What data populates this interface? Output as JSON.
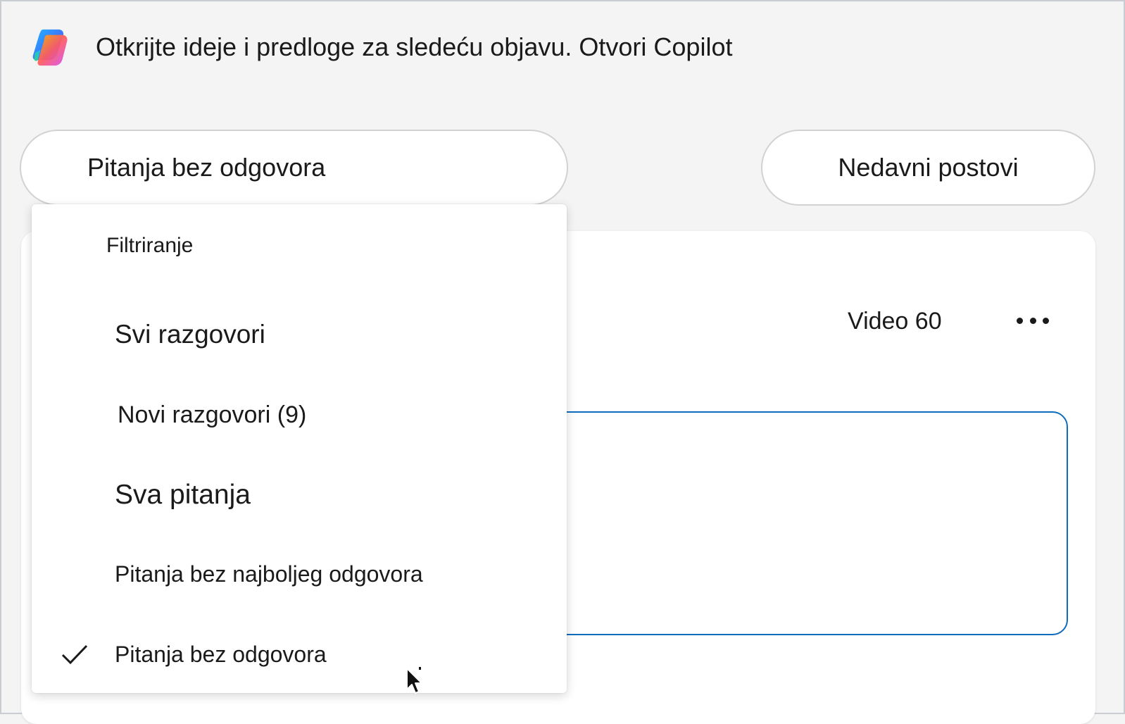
{
  "banner": {
    "text": "Otkrijte ideje i predloge za sledeću objavu. Otvori Copilot",
    "logo_icon": "copilot-logo-icon"
  },
  "filter_button": {
    "label": "Pitanja bez odgovora"
  },
  "recent_button": {
    "label": "Nedavni postovi"
  },
  "card": {
    "video_label": "Video 60",
    "more_icon": "more-horizontal-icon"
  },
  "menu": {
    "header": "Filtriranje",
    "items": [
      {
        "label": "Svi razgovori",
        "selected": false
      },
      {
        "label": "Novi razgovori (9)",
        "selected": false
      },
      {
        "label": "Sva pitanja",
        "selected": false
      },
      {
        "label": "Pitanja bez najboljeg odgovora",
        "selected": false
      },
      {
        "label": "Pitanja bez odgovora",
        "selected": true
      }
    ]
  },
  "colors": {
    "background": "#f4f4f4",
    "surface": "#ffffff",
    "accent": "#0f6cbd",
    "text": "#1a1a1a"
  }
}
